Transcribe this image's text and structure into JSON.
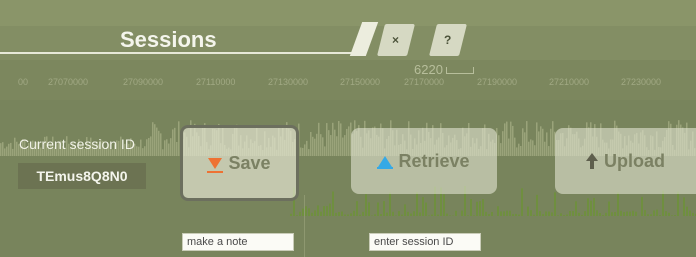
{
  "panel": {
    "title": "Sessions",
    "close_label": "×",
    "help_label": "?",
    "current_session_label": "Current session ID",
    "current_session_id": "TEmus8Q8N0"
  },
  "buttons": {
    "save": {
      "label": "Save",
      "icon": "down-arrow-icon",
      "icon_color": "#ee7233"
    },
    "retrieve": {
      "label": "Retrieve",
      "icon": "up-arrow-icon",
      "icon_color": "#35a9e6"
    },
    "upload": {
      "label": "Upload",
      "icon": "upload-arrow-icon",
      "icon_color": "#5e5f4d"
    }
  },
  "inputs": {
    "note_placeholder": "make a note",
    "session_id_placeholder": "enter session ID"
  },
  "background": {
    "scale_label": "6220",
    "coordinates": [
      "00",
      "27070000",
      "27090000",
      "27110000",
      "27130000",
      "27150000",
      "27170000",
      "27190000",
      "27210000",
      "27230000"
    ]
  }
}
